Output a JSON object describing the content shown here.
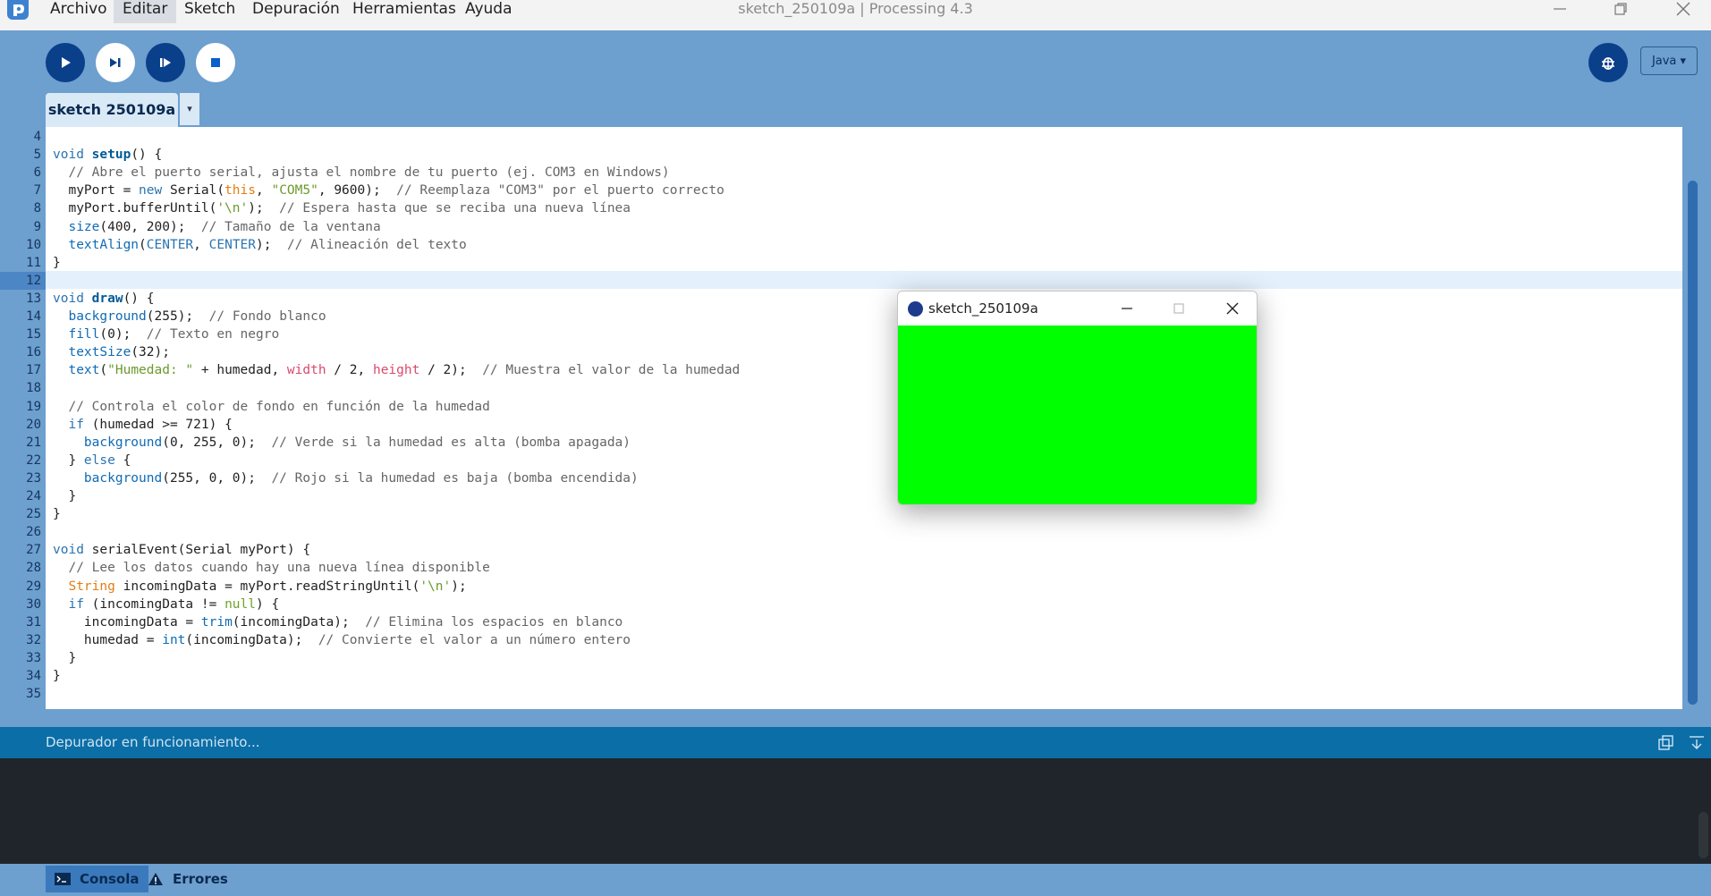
{
  "window": {
    "title": "sketch_250109a | Processing 4.3"
  },
  "menu": {
    "items": [
      "Archivo",
      "Editar",
      "Sketch",
      "Depuración",
      "Herramientas",
      "Ayuda"
    ],
    "active": "Editar"
  },
  "toolbar": {
    "buttons": [
      "run-icon",
      "step-icon",
      "continue-icon",
      "stop-icon"
    ],
    "debug_icon": "debugger-icon",
    "mode": "Java ▾"
  },
  "tabs": {
    "active": "sketch 250109a",
    "menu_glyph": "▾"
  },
  "editor": {
    "first_line_number": 4,
    "current_line": 12,
    "lines": [
      "",
      "void setup() {",
      "  // Abre el puerto serial, ajusta el nombre de tu puerto (ej. COM3 en Windows)",
      "  myPort = new Serial(this, \"COM5\", 9600);  // Reemplaza \"COM3\" por el puerto correcto",
      "  myPort.bufferUntil('\\n');  // Espera hasta que se reciba una nueva línea",
      "  size(400, 200);  // Tamaño de la ventana",
      "  textAlign(CENTER, CENTER);  // Alineación del texto",
      "}",
      "",
      "void draw() {",
      "  background(255);  // Fondo blanco",
      "  fill(0);  // Texto en negro",
      "  textSize(32);",
      "  text(\"Humedad: \" + humedad, width / 2, height / 2);  // Muestra el valor de la humedad",
      "",
      "  // Controla el color de fondo en función de la humedad",
      "  if (humedad >= 721) {",
      "    background(0, 255, 0);  // Verde si la humedad es alta (bomba apagada)",
      "  } else {",
      "    background(255, 0, 0);  // Rojo si la humedad es baja (bomba encendida)",
      "  }",
      "}",
      "",
      "void serialEvent(Serial myPort) {",
      "  // Lee los datos cuando hay una nueva línea disponible",
      "  String incomingData = myPort.readStringUntil('\\n');",
      "  if (incomingData != null) {",
      "    incomingData = trim(incomingData);  // Elimina los espacios en blanco",
      "    humedad = int(incomingData);  // Convierte el valor a un número entero",
      "  }",
      "}",
      ""
    ]
  },
  "status": {
    "message": "Depurador en funcionamiento..."
  },
  "console": {
    "tabs": [
      "Consola",
      "Errores"
    ],
    "active": "Consola"
  },
  "sketch_window": {
    "title": "sketch_250109a",
    "canvas_color": "#00ff00"
  },
  "colors": {
    "accent": "#6d9fcf",
    "status_bar": "#0b6ea6",
    "console_bg": "#1f252b"
  }
}
